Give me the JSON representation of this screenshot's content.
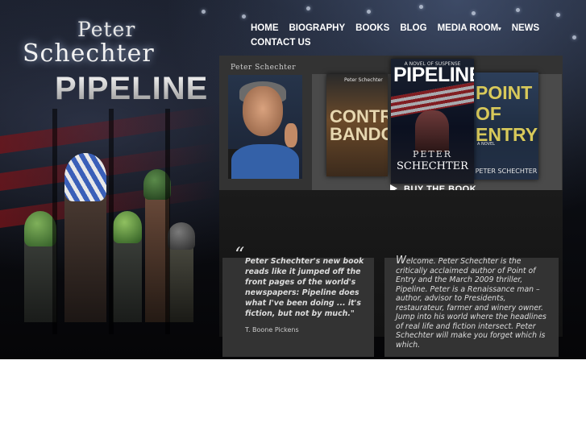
{
  "logo": {
    "line1": "Peter",
    "line2": "Schechter",
    "line3": "PIPELINE"
  },
  "nav": {
    "items": [
      "HOME",
      "BIOGRAPHY",
      "BOOKS",
      "BLOG",
      "MEDIA ROOM",
      "NEWS",
      "CONTACT US"
    ],
    "media_room_caret": "▾"
  },
  "photo": {
    "label": "Peter Schechter"
  },
  "books": {
    "contrabando": {
      "author": "Peter Schechter",
      "title": "CONTRA BANDO"
    },
    "pipeline": {
      "tagline": "A NOVEL OF SUSPENSE",
      "title": "PIPELINE",
      "author_first": "PETER",
      "author_last": "SCHECHTER"
    },
    "point_of_entry": {
      "title": "POINT OF ENTRY",
      "subtitle": "A NOVEL",
      "author": "PETER SCHECHTER"
    }
  },
  "buy_button": {
    "label": "BUY THE BOOK"
  },
  "quote": {
    "mark": "“",
    "text": "Peter Schechter's new book reads like it jumped off the front pages of the world's newspapers:  Pipeline does what I've been doing ... it's fiction, but not by much.\"",
    "author": "T. Boone Pickens"
  },
  "welcome": {
    "first_letter": "W",
    "text": "elcome.  Peter Schechter is the critically acclaimed author of Point of Entry and the March 2009 thriller, Pipeline.  Peter is a Renaissance man – author, advisor to Presidents, restaurateur, farmer and winery owner. Jump into his world where the headlines of real life and fiction intersect. Peter Schechter will make you forget which is which."
  }
}
